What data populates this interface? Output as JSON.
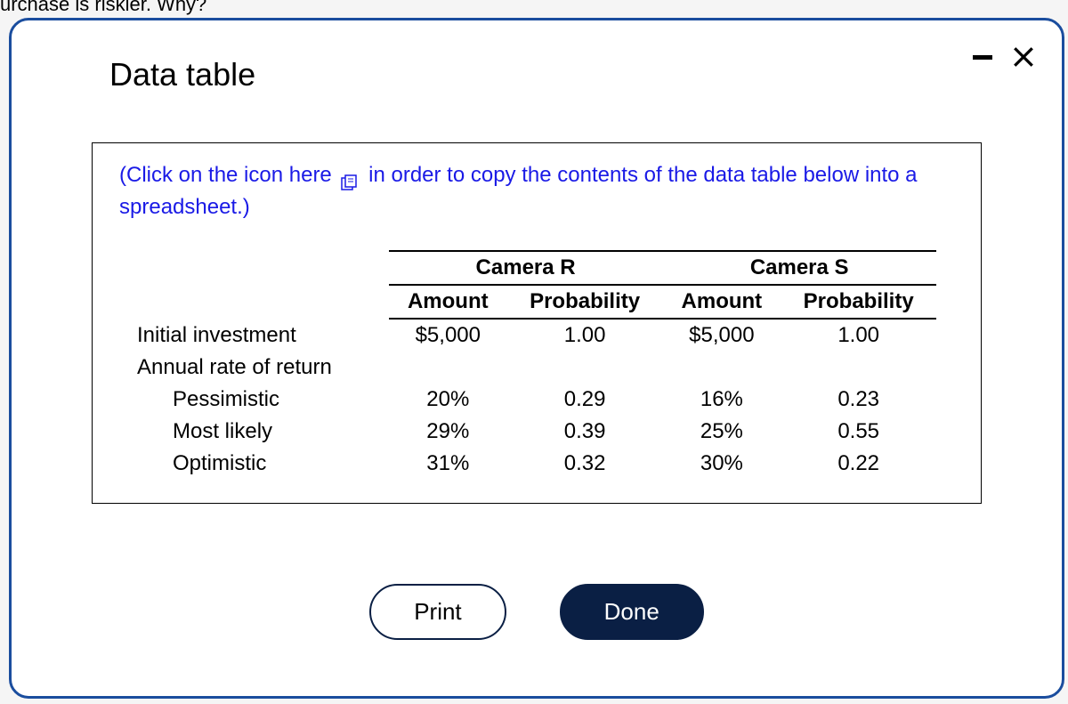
{
  "backdrop_text": "urchase is riskier.  Why?",
  "modal": {
    "title": "Data table",
    "instruction_prefix": "(Click on the icon here",
    "instruction_suffix": "in order to copy the contents of the data table below into a spreadsheet.)"
  },
  "table": {
    "group1": "Camera R",
    "group2": "Camera S",
    "col_amount": "Amount",
    "col_probability": "Probability",
    "rows": {
      "initial_investment": {
        "label": "Initial investment",
        "r_amount": "$5,000",
        "r_prob": "1.00",
        "s_amount": "$5,000",
        "s_prob": "1.00"
      },
      "annual_rate": {
        "label": "Annual rate of return"
      },
      "pessimistic": {
        "label": "Pessimistic",
        "r_amount": "20%",
        "r_prob": "0.29",
        "s_amount": "16%",
        "s_prob": "0.23"
      },
      "most_likely": {
        "label": "Most likely",
        "r_amount": "29%",
        "r_prob": "0.39",
        "s_amount": "25%",
        "s_prob": "0.55"
      },
      "optimistic": {
        "label": "Optimistic",
        "r_amount": "31%",
        "r_prob": "0.32",
        "s_amount": "30%",
        "s_prob": "0.22"
      }
    }
  },
  "buttons": {
    "print": "Print",
    "done": "Done"
  },
  "chart_data": {
    "type": "table",
    "title": "Data table",
    "columns": [
      "",
      "Camera R Amount",
      "Camera R Probability",
      "Camera S Amount",
      "Camera S Probability"
    ],
    "rows": [
      [
        "Initial investment",
        "$5,000",
        1.0,
        "$5,000",
        1.0
      ],
      [
        "Annual rate of return",
        "",
        "",
        "",
        ""
      ],
      [
        "Pessimistic",
        "20%",
        0.29,
        "16%",
        0.23
      ],
      [
        "Most likely",
        "29%",
        0.39,
        "25%",
        0.55
      ],
      [
        "Optimistic",
        "31%",
        0.32,
        "30%",
        0.22
      ]
    ]
  }
}
